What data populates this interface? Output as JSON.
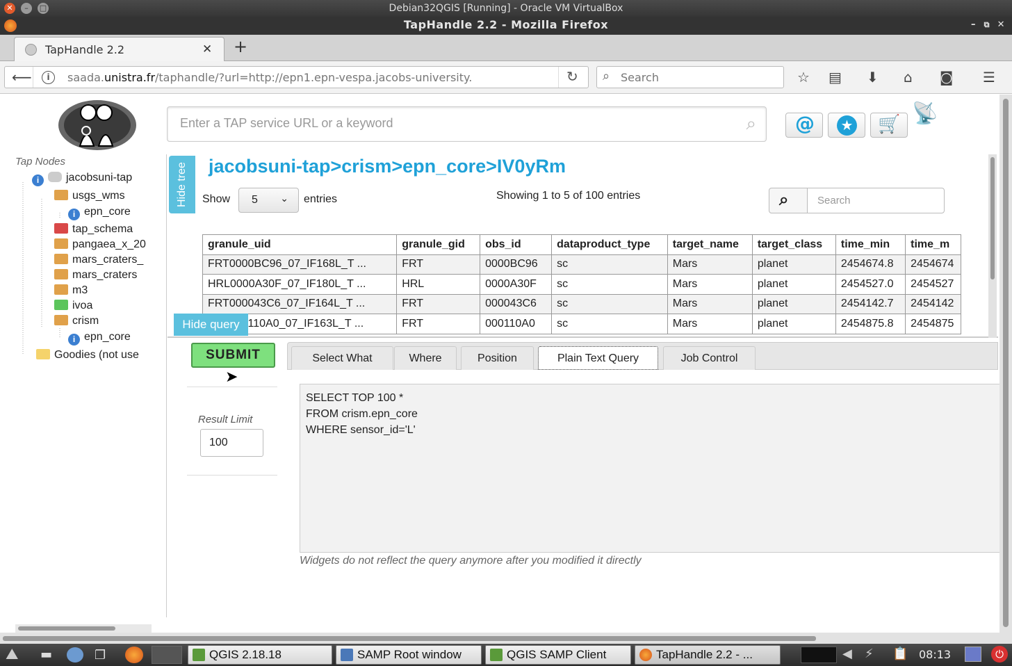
{
  "vbox_title": "Debian32QGIS [Running] - Oracle VM VirtualBox",
  "window_title": "TapHandle 2.2 - Mozilla Firefox",
  "browser": {
    "tab_title": "TapHandle 2.2",
    "url_prefix": "saada.",
    "url_domain": "unistra.fr",
    "url_rest": "/taphandle/?url=http://epn1.epn-vespa.jacobs-university.",
    "search_placeholder": "Search"
  },
  "app": {
    "search_placeholder": "Enter a TAP service URL or a keyword"
  },
  "tree": {
    "header": "Tap Nodes",
    "nodes": [
      {
        "label": "jacobsuni-tap"
      },
      {
        "label": "usgs_wms"
      },
      {
        "label": "epn_core"
      },
      {
        "label": "tap_schema"
      },
      {
        "label": "pangaea_x_20"
      },
      {
        "label": "mars_craters_"
      },
      {
        "label": "mars_craters"
      },
      {
        "label": "m3"
      },
      {
        "label": "ivoa"
      },
      {
        "label": "crism"
      },
      {
        "label": "epn_core"
      },
      {
        "label": "Goodies (not use"
      }
    ]
  },
  "main": {
    "hide_tree": "Hide tree",
    "title": "jacobsuni-tap>crism>epn_core>IV0yRm",
    "show_label": "Show",
    "entries_value": "5",
    "entries_label": "entries",
    "showing": "Showing 1 to 5 of 100 entries",
    "search_placeholder": "Search",
    "columns": [
      "granule_uid",
      "granule_gid",
      "obs_id",
      "dataproduct_type",
      "target_name",
      "target_class",
      "time_min",
      "time_m"
    ],
    "rows": [
      [
        "FRT0000BC96_07_IF168L_T ...",
        "FRT",
        "0000BC96",
        "sc",
        "Mars",
        "planet",
        "2454674.8",
        "2454674"
      ],
      [
        "HRL0000A30F_07_IF180L_T ...",
        "HRL",
        "0000A30F",
        "sc",
        "Mars",
        "planet",
        "2454527.0",
        "2454527"
      ],
      [
        "FRT000043C6_07_IF164L_T ...",
        "FRT",
        "000043C6",
        "sc",
        "Mars",
        "planet",
        "2454142.7",
        "2454142"
      ],
      [
        "FRT000110A0_07_IF163L_T ...",
        "FRT",
        "000110A0",
        "sc",
        "Mars",
        "planet",
        "2454875.8",
        "2454875"
      ]
    ]
  },
  "query": {
    "hide_query": "Hide query",
    "submit": "SUBMIT",
    "tabs": [
      "Select What",
      "Where",
      "Position",
      "Plain Text Query",
      "Job Control"
    ],
    "active_tab": "Plain Text Query",
    "result_limit_label": "Result Limit",
    "result_limit": "100",
    "text_lines": [
      "SELECT  TOP 100  *",
      "FROM crism.epn_core",
      "WHERE sensor_id='L'"
    ],
    "note": "Widgets do not reflect the query anymore after you modified it directly"
  },
  "taskbar": {
    "items": [
      "QGIS 2.18.18",
      "SAMP Root window",
      "QGIS SAMP Client",
      "TapHandle 2.2 - ..."
    ],
    "clock": "08:13"
  }
}
